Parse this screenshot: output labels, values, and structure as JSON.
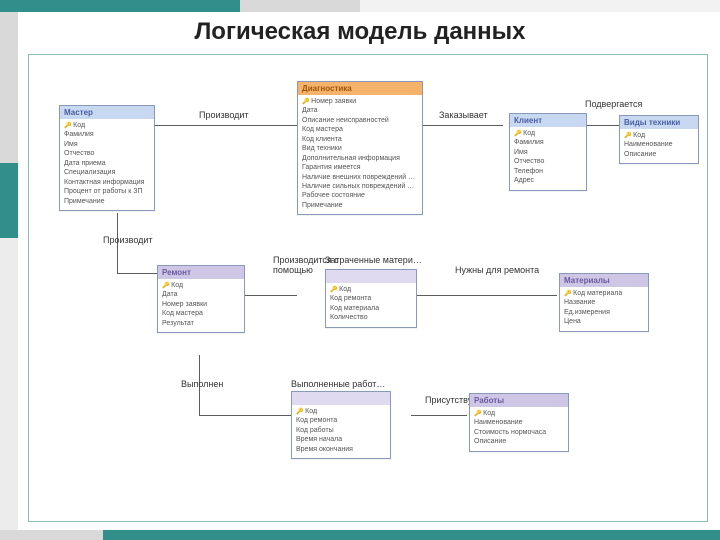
{
  "title": "Логическая модель данных",
  "labels": {
    "l_prod1": "Производит",
    "l_zak": "Заказывает",
    "l_pod": "Подвергается",
    "l_prod2": "Производит",
    "l_ph": "Производится с помощью",
    "l_zm": "Затраченные матери…",
    "l_nuzh": "Нужны для ремонта",
    "l_vyp": "Выполнен",
    "l_vr": "Выполненные работ…",
    "l_pris": "Присутствуют"
  },
  "entities": {
    "master": {
      "name": "Мастер",
      "fields": [
        "Код",
        "Фамилия",
        "Имя",
        "Отчество",
        "Дата приема",
        "Специализация",
        "Контактная информация",
        "Процент от работы к ЗП",
        "Примечание"
      ]
    },
    "diag": {
      "name": "Диагностика",
      "fields": [
        "Номер заявки",
        "Дата",
        "Описание неисправностей",
        "Код мастера",
        "Код клиента",
        "Вид техники",
        "Дополнительная информация",
        "Гарантия имеется",
        "Наличие внешних повреждений на корпусе",
        "Наличие сильных повреждений на корпусе",
        "Рабочее состояние",
        "Примечание"
      ]
    },
    "klient": {
      "name": "Клиент",
      "fields": [
        "Код",
        "Фамилия",
        "Имя",
        "Отчество",
        "Телефон",
        "Адрес"
      ]
    },
    "vidy": {
      "name": "Виды техники",
      "fields": [
        "Код",
        "Наименование",
        "Описание"
      ]
    },
    "remont": {
      "name": "Ремонт",
      "fields": [
        "Код",
        "Дата",
        "Номер заявки",
        "Код мастера",
        "Результат"
      ]
    },
    "zm": {
      "name": "",
      "fields": [
        "Код",
        "Код ремонта",
        "Код материала",
        "Количество"
      ]
    },
    "vr": {
      "name": "",
      "fields": [
        "Код",
        "Код ремонта",
        "Код работы",
        "Время начала",
        "Время окончания"
      ]
    },
    "materials": {
      "name": "Материалы",
      "fields": [
        "Код материала",
        "Название",
        "Ед.измерения",
        "Цена"
      ]
    },
    "raboty": {
      "name": "Работы",
      "fields": [
        "Код",
        "Наименование",
        "Стоимость нормочаса",
        "Описание"
      ]
    }
  }
}
